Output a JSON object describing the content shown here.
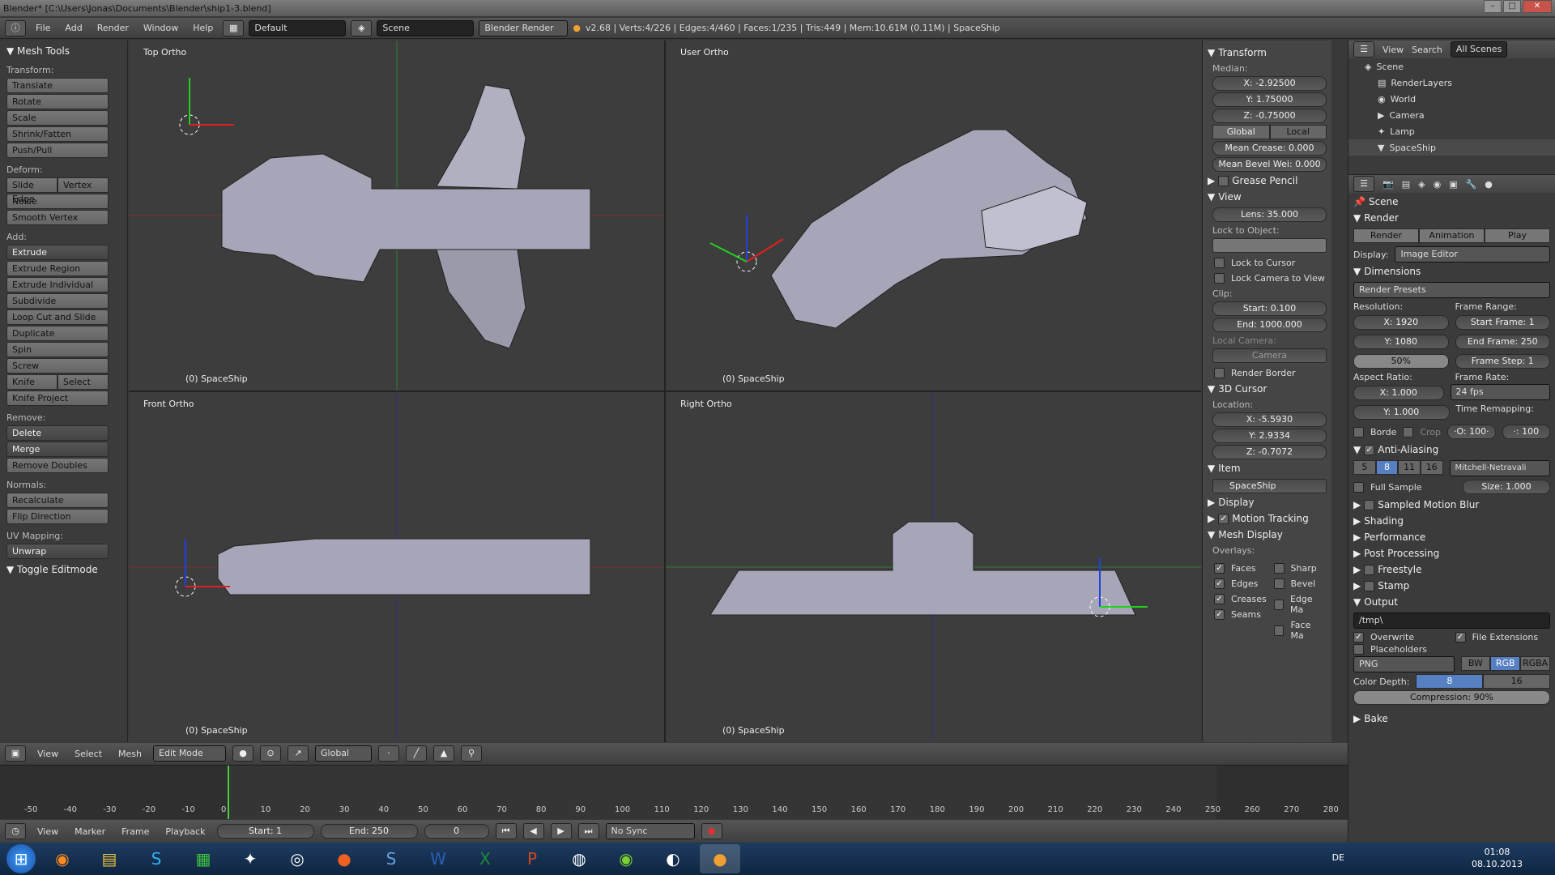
{
  "title": "Blender* [C:\\Users\\Jonas\\Documents\\Blender\\ship1-3.blend]",
  "info": {
    "menus": [
      "File",
      "Add",
      "Render",
      "Window",
      "Help"
    ],
    "layout": "Default",
    "scene": "Scene",
    "engine": "Blender Render",
    "stats": "v2.68 | Verts:4/226 | Edges:4/460 | Faces:1/235 | Tris:449 | Mem:10.61M (0.11M) | SpaceShip"
  },
  "toolshelf": {
    "title": "Mesh Tools",
    "sections": {
      "transform": "Transform:",
      "deform": "Deform:",
      "add": "Add:",
      "remove": "Remove:",
      "normals": "Normals:",
      "uv": "UV Mapping:"
    },
    "transform": [
      "Translate",
      "Rotate",
      "Scale",
      "Shrink/Fatten",
      "Push/Pull"
    ],
    "deform_pair": [
      "Slide Edge",
      "Vertex"
    ],
    "deform": [
      "Noise",
      "Smooth Vertex"
    ],
    "add_dd": "Extrude",
    "add": [
      "Extrude Region",
      "Extrude Individual",
      "Subdivide",
      "Loop Cut and Slide",
      "Duplicate",
      "Spin",
      "Screw"
    ],
    "knife_pair": [
      "Knife",
      "Select"
    ],
    "knife_project": "Knife Project",
    "remove_dd": [
      "Delete",
      "Merge"
    ],
    "remove": "Remove Doubles",
    "normals": [
      "Recalculate",
      "Flip Direction"
    ],
    "uv_dd": "Unwrap",
    "toggle": "Toggle Editmode"
  },
  "viewports": {
    "top": "Top Ortho",
    "user": "User Ortho",
    "front": "Front Ortho",
    "right": "Right Ortho",
    "object": "(0) SpaceShip"
  },
  "npanel": {
    "transform": "Transform",
    "median": "Median:",
    "x": "X: -2.92500",
    "y": "Y: 1.75000",
    "z": "Z: -0.75000",
    "global": "Global",
    "local": "Local",
    "crease": "Mean Crease: 0.000",
    "bevel": "Mean Bevel Wei: 0.000",
    "grease": "Grease Pencil",
    "view": "View",
    "lens": "Lens: 35.000",
    "lock_obj": "Lock to Object:",
    "lock_cursor": "Lock to Cursor",
    "lock_cam": "Lock Camera to View",
    "clip": "Clip:",
    "start": "Start: 0.100",
    "end": "End: 1000.000",
    "local_camera": "Local Camera:",
    "camera": "Camera",
    "render_border": "Render Border",
    "cursor": "3D Cursor",
    "location": "Location:",
    "cx": "X: -5.5930",
    "cy": "Y: 2.9334",
    "cz": "Z: -0.7072",
    "item": "Item",
    "item_name": "SpaceShip",
    "display": "Display",
    "motion": "Motion Tracking",
    "mesh_display": "Mesh Display",
    "overlays": "Overlays:",
    "ov_left": [
      "Faces",
      "Edges",
      "Creases",
      "Seams"
    ],
    "ov_right": [
      "Sharp",
      "Bevel",
      "Edge Ma",
      "Face Ma"
    ]
  },
  "outliner": {
    "view": "View",
    "search": "Search",
    "all_scenes": "All Scenes",
    "items": [
      "Scene",
      "RenderLayers",
      "World",
      "Camera",
      "Lamp",
      "SpaceShip"
    ]
  },
  "props": {
    "scene": "Scene",
    "render": "Render",
    "btn_render": "Render",
    "btn_anim": "Animation",
    "btn_play": "Play",
    "display_lbl": "Display:",
    "display_val": "Image Editor",
    "dimensions": "Dimensions",
    "presets": "Render Presets",
    "resolution": "Resolution:",
    "frame_range": "Frame Range:",
    "resx": "X: 1920",
    "resy": "Y: 1080",
    "pct": "50%",
    "fstart": "Start Frame: 1",
    "fend": "End Frame: 250",
    "fstep": "Frame Step: 1",
    "aspect": "Aspect Ratio:",
    "frame_rate": "Frame Rate:",
    "ax": "X: 1.000",
    "ay": "Y: 1.000",
    "fps": "24 fps",
    "remap": "Time Remapping:",
    "border": "Borde",
    "crop": "Crop",
    "remap_o": "·O: 100·",
    "remap_n": "·: 100",
    "aa": "Anti-Aliasing",
    "aa_vals": [
      "5",
      "8",
      "11",
      "16"
    ],
    "filter": "Mitchell-Netravali",
    "full_sample": "Full Sample",
    "size": "Size: 1.000",
    "smb": "Sampled Motion Blur",
    "shading": "Shading",
    "performance": "Performance",
    "post": "Post Processing",
    "freestyle": "Freestyle",
    "stamp": "Stamp",
    "output": "Output",
    "path": "/tmp\\",
    "overwrite": "Overwrite",
    "ext": "File Extensions",
    "placeholders": "Placeholders",
    "format": "PNG",
    "bw": "BW",
    "rgb": "RGB",
    "rgba": "RGBA",
    "depth": "Color Depth:",
    "d8": "8",
    "d16": "16",
    "compression": "Compression: 90%",
    "bake": "Bake"
  },
  "viewhead": {
    "menus": [
      "View",
      "Select",
      "Mesh"
    ],
    "mode": "Edit Mode",
    "orient": "Global"
  },
  "timeline": {
    "ticks": [
      "-50",
      "-40",
      "-30",
      "-20",
      "-10",
      "0",
      "10",
      "20",
      "30",
      "40",
      "50",
      "60",
      "70",
      "80",
      "90",
      "100",
      "110",
      "120",
      "130",
      "140",
      "150",
      "160",
      "170",
      "180",
      "190",
      "200",
      "210",
      "220",
      "230",
      "240",
      "250",
      "260",
      "270",
      "280"
    ],
    "menus": [
      "View",
      "Marker",
      "Frame",
      "Playback"
    ],
    "start": "Start: 1",
    "end": "End: 250",
    "current": "0",
    "sync": "No Sync"
  },
  "taskbar": {
    "lang": "DE",
    "time": "01:08",
    "date": "08.10.2013"
  },
  "colors": {
    "accent": "#5680c2",
    "mesh": "#a6a6b8",
    "x_axis": "#e02020",
    "y_axis": "#20d020",
    "z_axis": "#2040e0"
  }
}
